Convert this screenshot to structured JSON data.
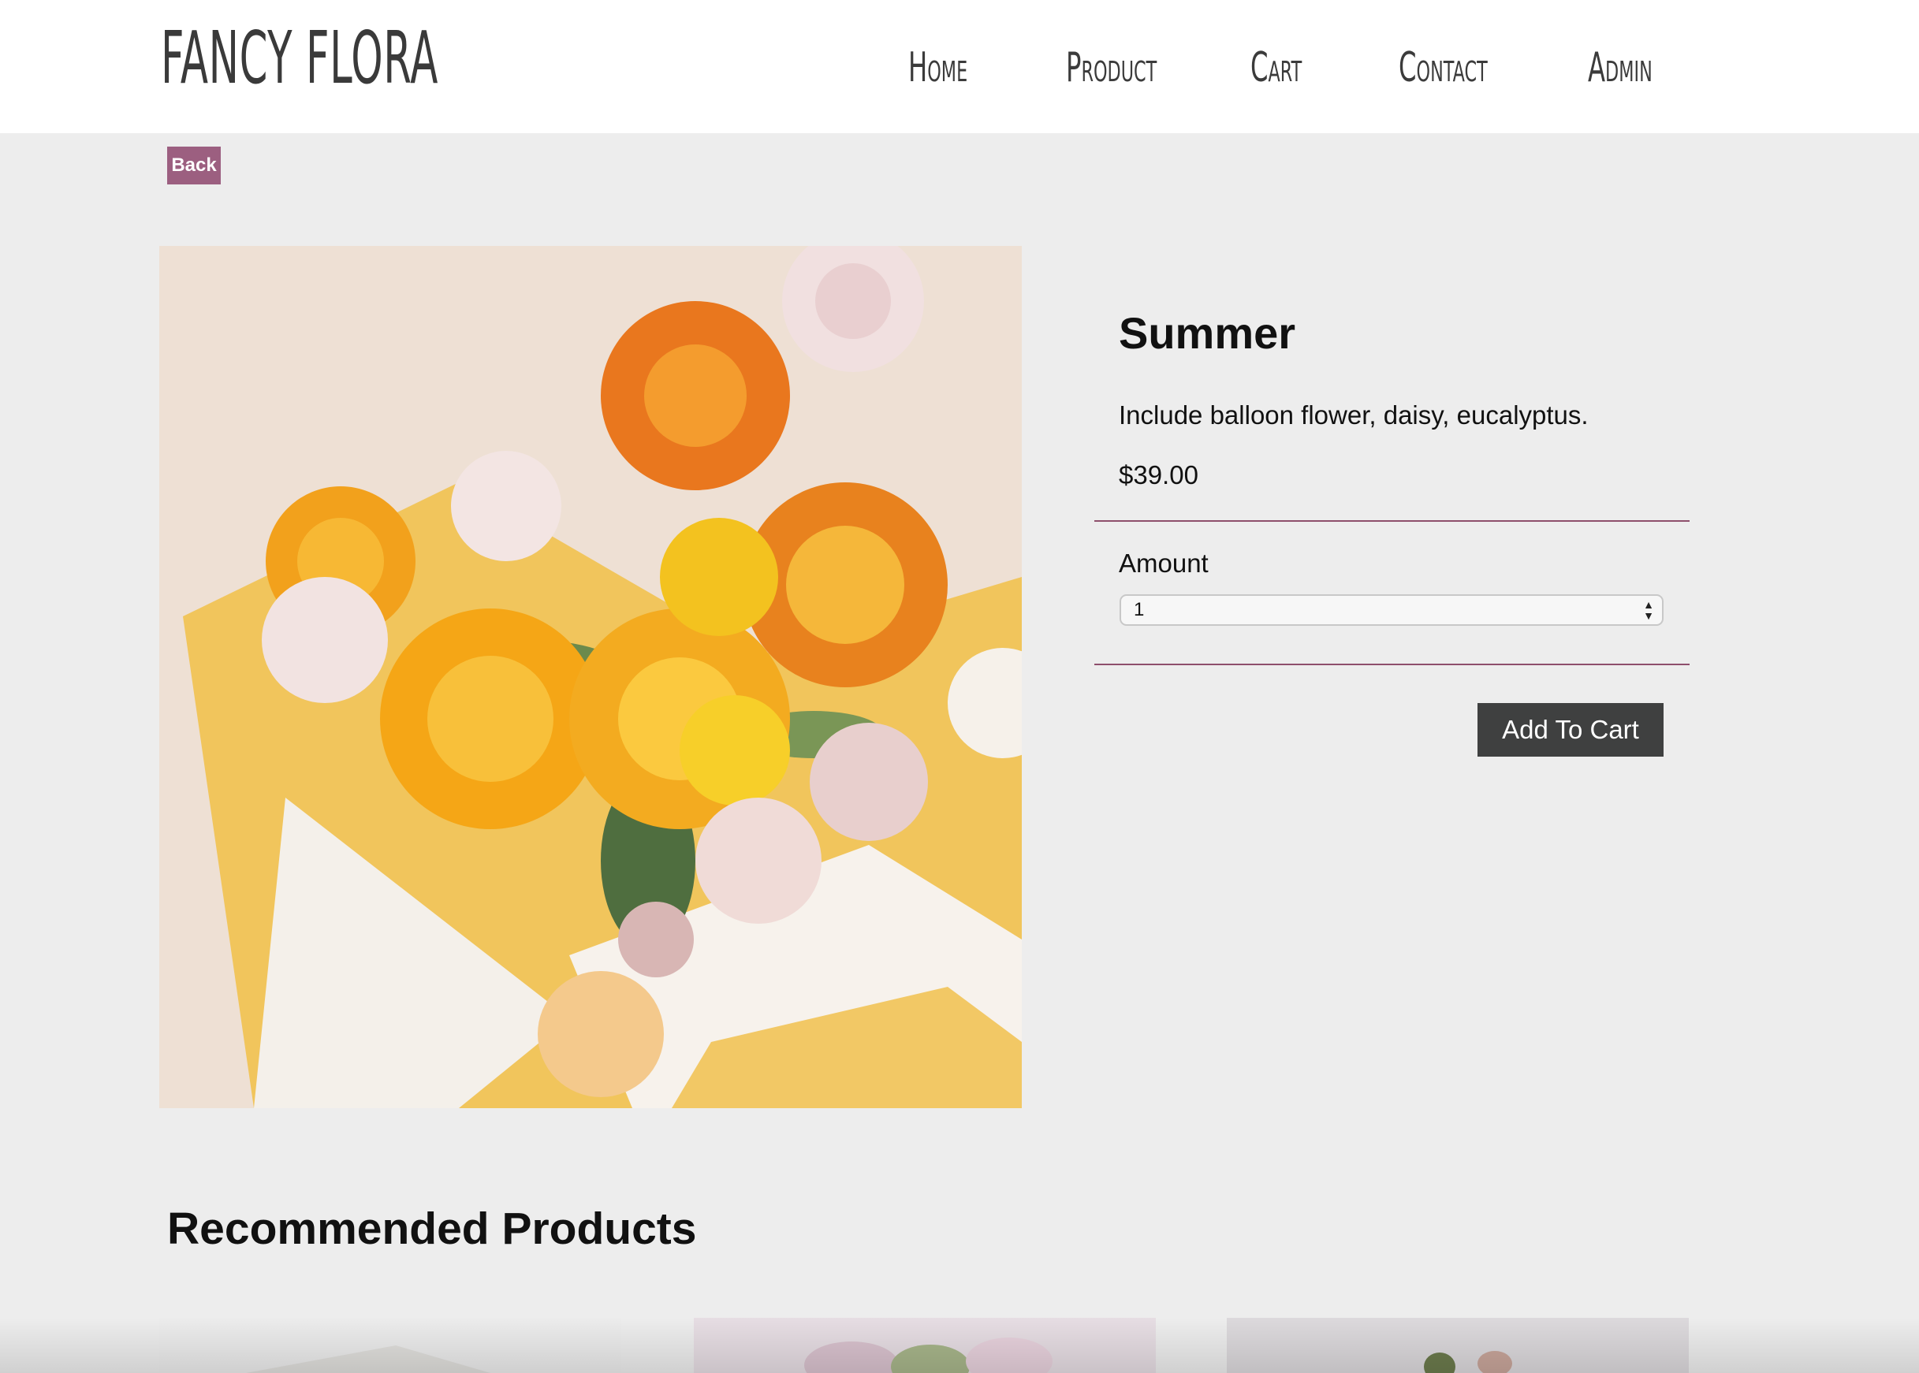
{
  "header": {
    "logo": "FANCY FLORA",
    "nav": [
      "Home",
      "Product",
      "Cart",
      "Contact",
      "Admin"
    ]
  },
  "back_label": "Back",
  "product": {
    "title": "Summer",
    "description": "Include balloon flower, daisy, eucalyptus.",
    "price": "$39.00",
    "amount_label": "Amount",
    "amount_value": "1",
    "add_to_cart_label": "Add To Cart"
  },
  "recommended": {
    "title": "Recommended Products"
  },
  "colors": {
    "accent": "#9c5f80",
    "divider": "#8e4f6c",
    "button_dark": "#3f4040",
    "background": "#ededed"
  }
}
